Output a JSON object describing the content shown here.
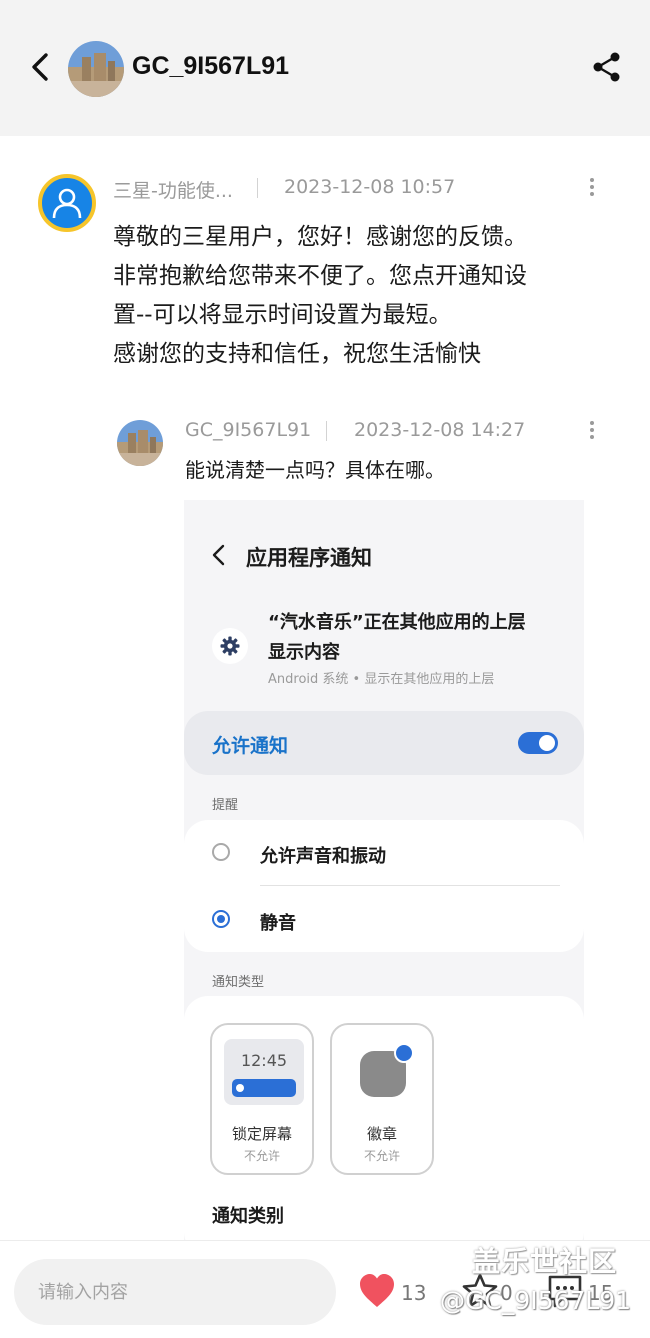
{
  "header": {
    "title": "GC_9I567L91"
  },
  "comments": [
    {
      "author": "三星-功能使...",
      "time": "2023-12-08 10:57",
      "body": [
        "尊敬的三星用户，您好！感谢您的反馈。",
        "非常抱歉给您带来不便了。您点开通知设",
        "置--可以将显示时间设置为最短。",
        "感谢您的支持和信任，祝您生活愉快"
      ]
    },
    {
      "author": "GC_9I567L91",
      "time": "2023-12-08 14:27",
      "body": "能说清楚一点吗？具体在哪。"
    }
  ],
  "screenshot": {
    "title": "应用程序通知",
    "app_line1": "“汽水音乐”正在其他应用的上层",
    "app_line2": "显示内容",
    "app_sub": "Android 系统 • 显示在其他应用的上层",
    "allow_label": "允许通知",
    "allow_on": true,
    "reminder_section": "提醒",
    "option1": "允许声音和振动",
    "option2": "静音",
    "selected_option": "静音",
    "types_section": "通知类型",
    "lock_time": "12:45",
    "tile1_label": "锁定屏幕",
    "tile1_sub": "不允许",
    "tile2_label": "徽章",
    "tile2_sub": "不允许",
    "category_label": "通知类别"
  },
  "bottom": {
    "input_placeholder": "请输入内容",
    "likes": "13",
    "favorites": "0",
    "comments": "15"
  },
  "watermark": {
    "line1": "盖乐世社区",
    "line2": "@GC_9I567L91"
  },
  "colors": {
    "accent": "#2b6fd6",
    "like": "#f0525f",
    "header_bg": "#f3f3f3"
  },
  "icons": [
    "back-arrow-icon",
    "share-icon",
    "more-vert-icon",
    "user-icon",
    "settings-gear-icon",
    "heart-icon",
    "star-icon",
    "comment-icon"
  ]
}
